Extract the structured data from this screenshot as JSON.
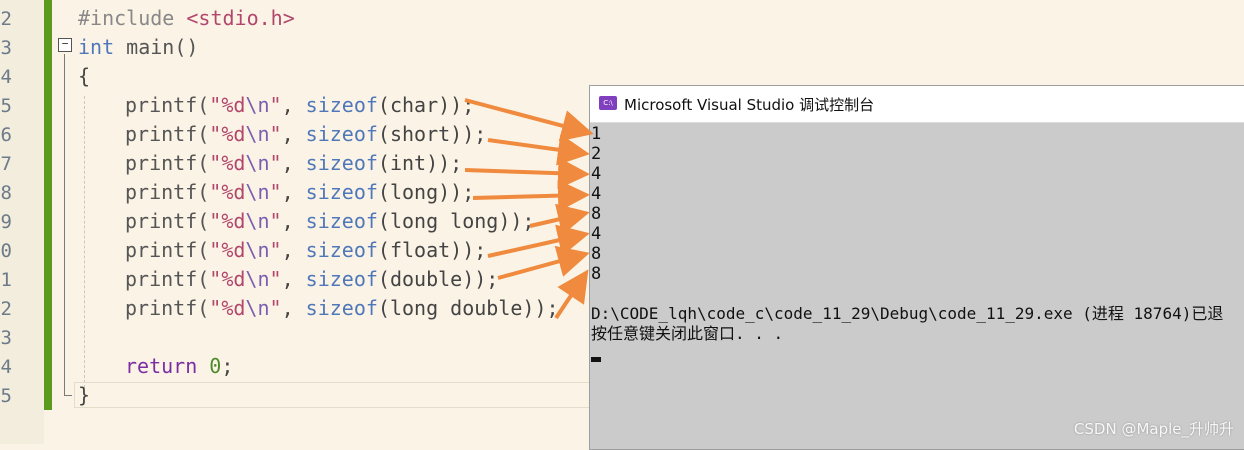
{
  "editor": {
    "line_numbers": [
      "2",
      "3",
      "4",
      "5",
      "6",
      "7",
      "8",
      "9",
      "0",
      "1",
      "2",
      "3",
      "4",
      "5"
    ],
    "include_directive": "#include ",
    "include_header": "<stdio.h>",
    "main_type": "int",
    "main_name": " main()",
    "open_brace": "{",
    "close_brace": "}",
    "printf_lines": [
      {
        "fn": "printf(",
        "fmt_open": "\"%d",
        "fmt_esc": "\\n",
        "fmt_close": "\"",
        "rest_a": ", ",
        "sizeof": "sizeof",
        "arg": "(char)",
        "end": ");"
      },
      {
        "fn": "printf(",
        "fmt_open": "\"%d",
        "fmt_esc": "\\n",
        "fmt_close": "\"",
        "rest_a": ", ",
        "sizeof": "sizeof",
        "arg": "(short)",
        "end": ");"
      },
      {
        "fn": "printf(",
        "fmt_open": "\"%d",
        "fmt_esc": "\\n",
        "fmt_close": "\"",
        "rest_a": ", ",
        "sizeof": "sizeof",
        "arg": "(int)",
        "end": ");"
      },
      {
        "fn": "printf(",
        "fmt_open": "\"%d",
        "fmt_esc": "\\n",
        "fmt_close": "\"",
        "rest_a": ", ",
        "sizeof": "sizeof",
        "arg": "(long)",
        "end": ");"
      },
      {
        "fn": "printf(",
        "fmt_open": "\"%d",
        "fmt_esc": "\\n",
        "fmt_close": "\"",
        "rest_a": ", ",
        "sizeof": "sizeof",
        "arg": "(long long)",
        "end": ");"
      },
      {
        "fn": "printf(",
        "fmt_open": "\"%d",
        "fmt_esc": "\\n",
        "fmt_close": "\"",
        "rest_a": ", ",
        "sizeof": "sizeof",
        "arg": "(float)",
        "end": ");"
      },
      {
        "fn": "printf(",
        "fmt_open": "\"%d",
        "fmt_esc": "\\n",
        "fmt_close": "\"",
        "rest_a": ", ",
        "sizeof": "sizeof",
        "arg": "(double)",
        "end": ");"
      },
      {
        "fn": "printf(",
        "fmt_open": "\"%d",
        "fmt_esc": "\\n",
        "fmt_close": "\"",
        "rest_a": ", ",
        "sizeof": "sizeof",
        "arg": "(long double)",
        "end": ");"
      }
    ],
    "return_kw": "return",
    "return_val": " 0",
    "return_end": ";"
  },
  "console": {
    "title": "Microsoft Visual Studio 调试控制台",
    "icon_label": "C:\\",
    "icon_name": "vs-console-icon",
    "output_lines": [
      "1",
      "2",
      "4",
      "4",
      "8",
      "4",
      "8",
      "8"
    ],
    "exit_line": "D:\\CODE_lqh\\code_c\\code_11_29\\Debug\\code_11_29.exe (进程 18764)已退",
    "prompt_line": "按任意键关闭此窗口. . ."
  },
  "watermark": "CSDN @Maple_升帅升",
  "colors": {
    "editor_bg": "#fbf4e6",
    "change_bar": "#5c9a1e",
    "console_bg": "#cbcbcb",
    "arrow": "#f08a3e"
  }
}
